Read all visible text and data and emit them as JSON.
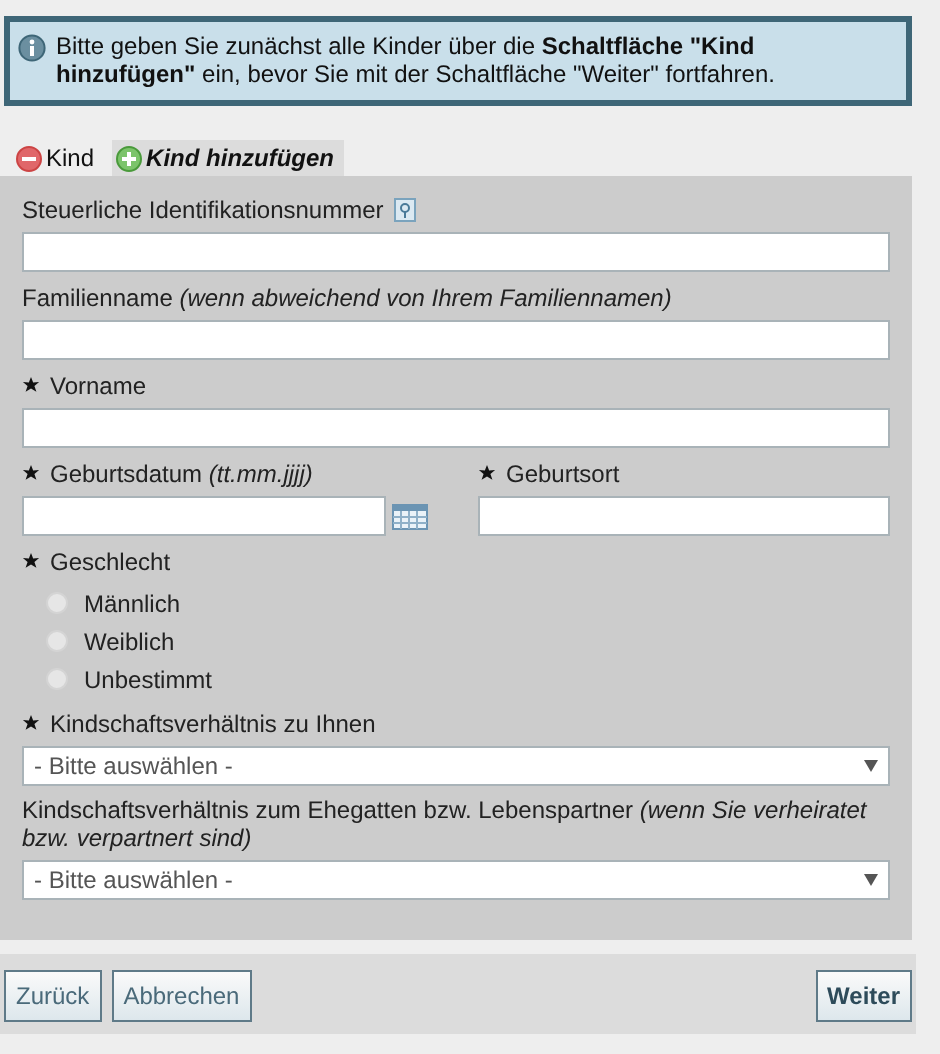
{
  "notice": {
    "text": "Bitte geben Sie zunächst alle Kinder über die **Schaltfläche \"Kind hinzufügen\"** ein, bevor Sie mit der Schaltfläche \"Weiter\" fortfahren."
  },
  "tabs": [
    {
      "label": "Kind",
      "kind": "remove",
      "selected": true
    },
    {
      "label": "Kind hinzufügen",
      "kind": "add",
      "selected": false
    }
  ],
  "form_rows": [
    {
      "fields": [
        {
          "kind": "text",
          "label": "Steuerliche Identifikationsnummer",
          "required": false,
          "help": true
        }
      ]
    },
    {
      "fields": [
        {
          "kind": "text",
          "label": "Familienname *(wenn abweichend von Ihrem Familiennamen)*",
          "required": false,
          "help": false
        }
      ]
    },
    {
      "fields": [
        {
          "kind": "text",
          "label": "Vorname",
          "required": true,
          "help": false
        }
      ]
    },
    {
      "fields": [
        {
          "kind": "date",
          "label": "Geburtsdatum *(tt.mm.jjjj)*",
          "required": true,
          "help": false
        },
        {
          "kind": "text",
          "label": "Geburtsort",
          "required": true,
          "help": false
        }
      ]
    },
    {
      "fields": [
        {
          "kind": "radio",
          "label": "Geschlecht",
          "required": true,
          "help": false,
          "options": [
            {
              "label": "Männlich",
              "selected": false
            },
            {
              "label": "Weiblich",
              "selected": false
            },
            {
              "label": "Unbestimmt",
              "selected": false
            }
          ]
        }
      ]
    },
    {
      "fields": [
        {
          "kind": "select",
          "label": "Kindschaftsverhältnis zu Ihnen",
          "required": true,
          "help": false,
          "value": "- Bitte auswählen -"
        }
      ]
    },
    {
      "fields": [
        {
          "kind": "select",
          "label": "Kindschaftsverhältnis zum Ehegatten bzw. Lebenspartner *(wenn Sie verheiratet bzw. verpartnert sind)*",
          "required": false,
          "help": false,
          "value": "- Bitte auswählen -"
        }
      ]
    }
  ],
  "buttons": [
    {
      "label": "Zurück",
      "primary": false
    },
    {
      "label": "Abbrechen",
      "primary": false
    },
    {
      "label": "Weiter",
      "primary": true
    }
  ]
}
